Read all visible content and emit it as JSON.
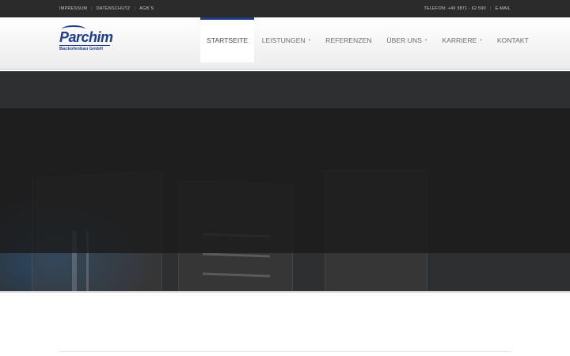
{
  "topbar": {
    "links": [
      "IMPRESSUM",
      "DATENSCHUTZ",
      "AGB´S"
    ],
    "phone": "TELEFON: +49 3871 - 62 590",
    "email": "E-MAIL"
  },
  "logo": {
    "name": "Parchim",
    "subtitle": "Backofenbau GmbH"
  },
  "nav": {
    "items": [
      {
        "label": "STARTSEITE",
        "active": true,
        "has_dropdown": false
      },
      {
        "label": "LEISTUNGEN",
        "active": false,
        "has_dropdown": true
      },
      {
        "label": "REFERENZEN",
        "active": false,
        "has_dropdown": false
      },
      {
        "label": "ÜBER UNS",
        "active": false,
        "has_dropdown": true
      },
      {
        "label": "KARRIERE",
        "active": false,
        "has_dropdown": true
      },
      {
        "label": "KONTAKT",
        "active": false,
        "has_dropdown": false
      }
    ],
    "caret_icon": "chevron-down-icon"
  },
  "colors": {
    "brand": "#1f3d8a",
    "topbar_bg": "#2b2b2b",
    "hero_bg": "#2e2f31"
  }
}
